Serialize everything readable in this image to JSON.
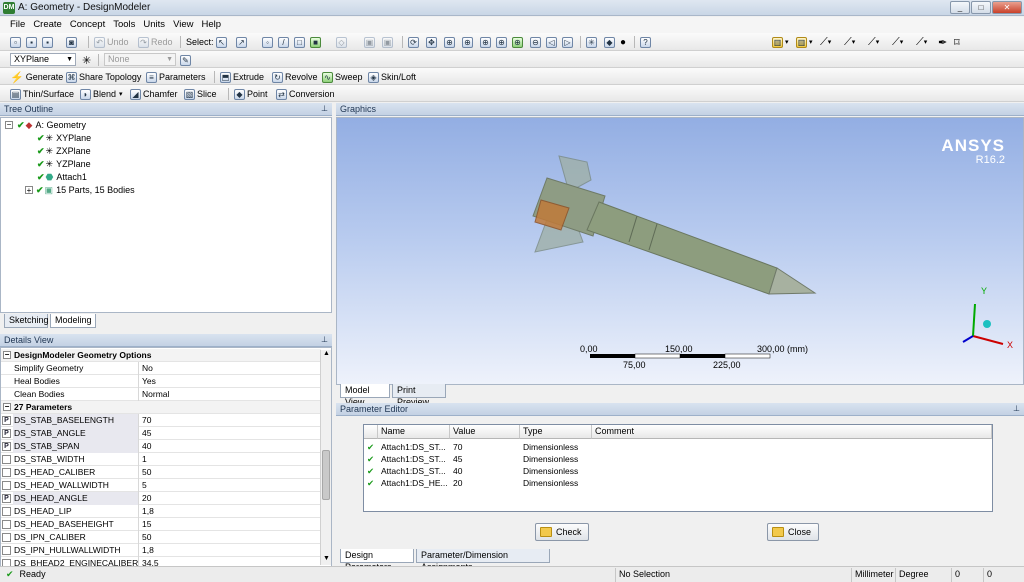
{
  "window": {
    "title": "A: Geometry - DesignModeler",
    "min": "_",
    "max": "□",
    "close": "✕"
  },
  "menu": [
    "File",
    "Create",
    "Concept",
    "Tools",
    "Units",
    "View",
    "Help"
  ],
  "toolbar1": {
    "undo": "Undo",
    "redo": "Redo",
    "select_label": "Select:"
  },
  "toolbar2": {
    "plane_combo": "XYPlane",
    "sketch_combo": "None"
  },
  "toolbar3": {
    "generate": "Generate",
    "share_topology": "Share Topology",
    "parameters": "Parameters",
    "extrude": "Extrude",
    "revolve": "Revolve",
    "sweep": "Sweep",
    "skin_loft": "Skin/Loft"
  },
  "toolbar4": {
    "thin_surface": "Thin/Surface",
    "blend": "Blend",
    "chamfer": "Chamfer",
    "slice": "Slice",
    "point": "Point",
    "conversion": "Conversion"
  },
  "tree": {
    "header": "Tree Outline",
    "root": "A: Geometry",
    "items": [
      "XYPlane",
      "ZXPlane",
      "YZPlane",
      "Attach1",
      "15 Parts, 15 Bodies"
    ],
    "tabs": [
      "Sketching",
      "Modeling"
    ]
  },
  "details": {
    "header": "Details View",
    "group1": "DesignModeler Geometry Options",
    "options": [
      {
        "k": "Simplify Geometry",
        "v": "No"
      },
      {
        "k": "Heal Bodies",
        "v": "Yes"
      },
      {
        "k": "Clean Bodies",
        "v": "Normal"
      }
    ],
    "group2": "27 Parameters",
    "params": [
      {
        "k": "DS_STAB_BASELENGTH",
        "v": "70",
        "p": "P"
      },
      {
        "k": "DS_STAB_ANGLE",
        "v": "45",
        "p": "P"
      },
      {
        "k": "DS_STAB_SPAN",
        "v": "40",
        "p": "P"
      },
      {
        "k": "DS_STAB_WIDTH",
        "v": "1",
        "p": ""
      },
      {
        "k": "DS_HEAD_CALIBER",
        "v": "50",
        "p": ""
      },
      {
        "k": "DS_HEAD_WALLWIDTH",
        "v": "5",
        "p": ""
      },
      {
        "k": "DS_HEAD_ANGLE",
        "v": "20",
        "p": "P"
      },
      {
        "k": "DS_HEAD_LIP",
        "v": "1,8",
        "p": ""
      },
      {
        "k": "DS_HEAD_BASEHEIGHT",
        "v": "15",
        "p": ""
      },
      {
        "k": "DS_IPN_CALIBER",
        "v": "50",
        "p": ""
      },
      {
        "k": "DS_IPN_HULLWALLWIDTH",
        "v": "1,8",
        "p": ""
      },
      {
        "k": "DS_BHEAD2_ENGINECALIBER",
        "v": "34,5",
        "p": ""
      }
    ]
  },
  "graphics": {
    "header": "Graphics",
    "logo": "ANSYS",
    "version": "R16.2",
    "scale_top": [
      "0,00",
      "150,00",
      "300,00 (mm)"
    ],
    "scale_bottom": [
      "75,00",
      "225,00"
    ],
    "axes": {
      "x": "X",
      "y": "Y"
    },
    "tabs": [
      "Model View",
      "Print Preview"
    ]
  },
  "param_editor": {
    "header": "Parameter Editor",
    "columns": [
      "Name",
      "Value",
      "Type",
      "Comment"
    ],
    "rows": [
      {
        "name": "Attach1:DS_ST...",
        "value": "70",
        "type": "Dimensionless"
      },
      {
        "name": "Attach1:DS_ST...",
        "value": "45",
        "type": "Dimensionless"
      },
      {
        "name": "Attach1:DS_ST...",
        "value": "40",
        "type": "Dimensionless"
      },
      {
        "name": "Attach1:DS_HE...",
        "value": "20",
        "type": "Dimensionless"
      }
    ],
    "check": "Check",
    "close": "Close",
    "tabs": [
      "Design Parameters",
      "Parameter/Dimension Assignments"
    ]
  },
  "status": {
    "ready": "Ready",
    "selection": "No Selection",
    "unit_len": "Millimeter",
    "unit_ang": "Degree",
    "v1": "0",
    "v2": "0"
  }
}
